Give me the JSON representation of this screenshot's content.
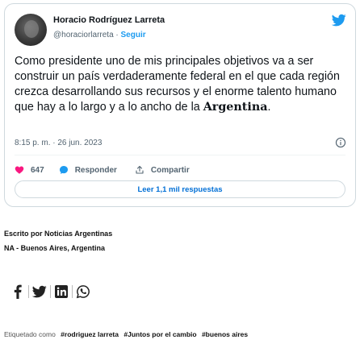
{
  "tweet": {
    "author_name": "Horacio Rodríguez Larreta",
    "handle": "@horaciorlarreta",
    "separator": " · ",
    "follow_label": "Seguir",
    "text_main": "Como presidente uno de mis principales objetivos va a ser construir un país verdaderamente federal en el que cada región crezca desarrollando sus recursos y el enorme talento humano que hay a lo largo y a lo ancho de la ",
    "text_bold": "Argentina",
    "text_end": ".",
    "timestamp": "8:15 p. m. · 26 jun. 2023",
    "likes": "647",
    "reply_label": "Responder",
    "share_label": "Compartir",
    "read_replies_label": "Leer 1,1 mil respuestas",
    "accent_color": "#1d9bf0",
    "like_color": "#f91880"
  },
  "article": {
    "written_by": "Escrito por Noticias Argentinas",
    "location": "NA - Buenos Aires, Argentina",
    "tagged_as": "Etiquetado como",
    "tags": [
      "#rodriguez larreta",
      "#Juntos por el cambio",
      "#buenos aires"
    ]
  },
  "share_icons": [
    "facebook-icon",
    "twitter-icon",
    "linkedin-icon",
    "whatsapp-icon"
  ]
}
